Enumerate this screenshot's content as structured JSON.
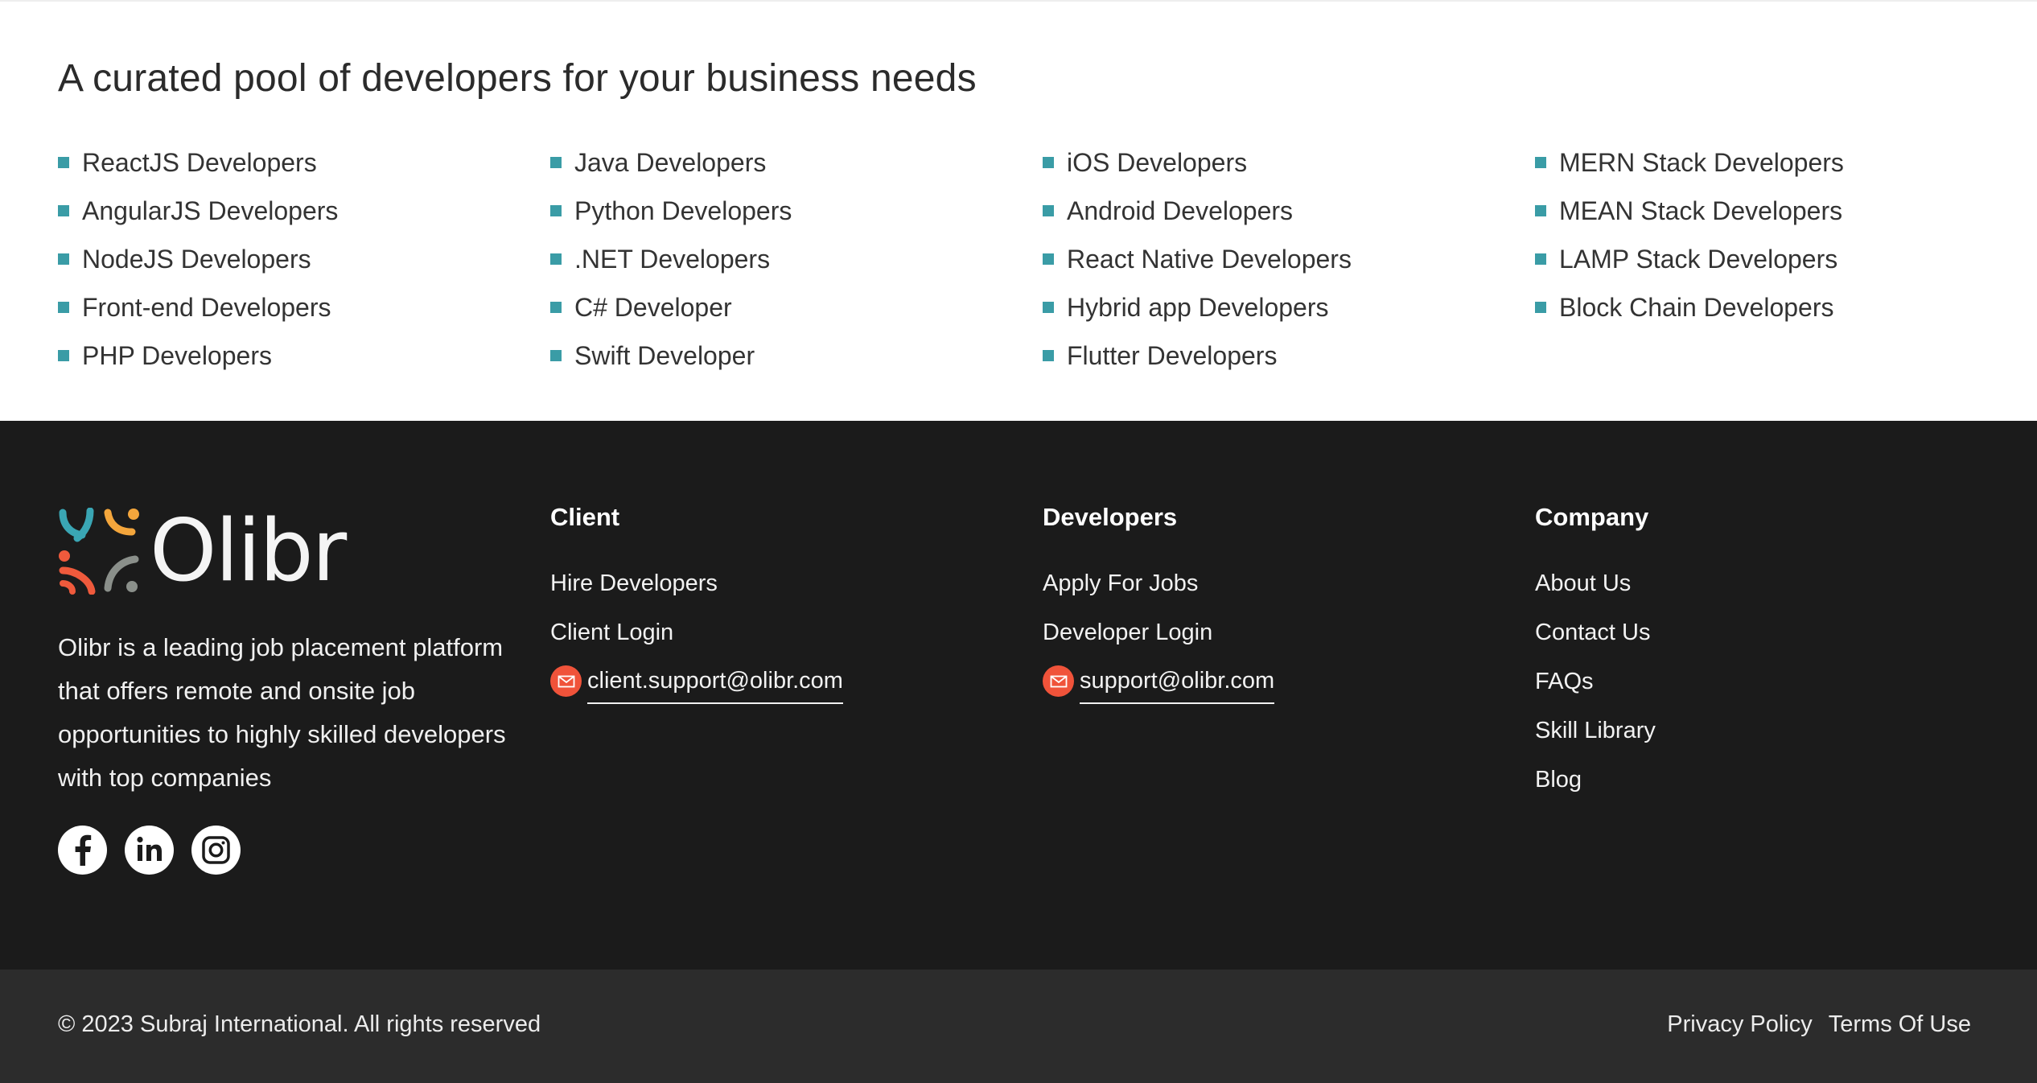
{
  "pool": {
    "title": "A curated pool of developers for your business needs",
    "columns": [
      [
        "ReactJS Developers",
        "AngularJS Developers",
        "NodeJS Developers",
        "Front-end Developers",
        "PHP Developers"
      ],
      [
        "Java Developers",
        "Python Developers",
        ".NET Developers",
        "C# Developer",
        "Swift Developer"
      ],
      [
        "iOS Developers",
        "Android Developers",
        "React Native Developers",
        "Hybrid app Developers",
        "Flutter Developers"
      ],
      [
        "MERN Stack Developers",
        "MEAN Stack Developers",
        "LAMP Stack Developers",
        "Block Chain Developers"
      ]
    ]
  },
  "footer": {
    "logo_text": "Olibr",
    "about": "Olibr is a leading job placement platform that offers remote and onsite job opportunities to highly skilled developers with top companies",
    "socials": [
      "facebook-icon",
      "linkedin-icon",
      "instagram-icon"
    ],
    "client": {
      "heading": "Client",
      "links": [
        "Hire Developers",
        "Client Login"
      ],
      "email": "client.support@olibr.com"
    },
    "developers": {
      "heading": "Developers",
      "links": [
        "Apply For Jobs",
        "Developer Login"
      ],
      "email": "support@olibr.com"
    },
    "company": {
      "heading": "Company",
      "links": [
        "About Us",
        "Contact Us",
        "FAQs",
        "Skill Library",
        "Blog"
      ]
    }
  },
  "bottom": {
    "copyright": "© 2023 Subraj International. All rights reserved",
    "privacy": "Privacy Policy",
    "terms": "Terms Of Use"
  },
  "colors": {
    "bullet": "#3a9ca6",
    "footer_bg": "#1b1b1b",
    "bottom_bg": "#2c2c2c",
    "mail_icon": "#f0533a",
    "logo_teal": "#3aa6b4",
    "logo_orange": "#f4a63c",
    "logo_red": "#ef5a3c",
    "logo_gray": "#8a8f8a"
  }
}
